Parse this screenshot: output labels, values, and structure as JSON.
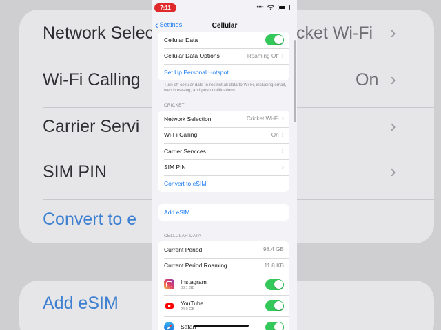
{
  "status_bar": {
    "time": "7:11"
  },
  "nav": {
    "back_label": "Settings",
    "title": "Cellular"
  },
  "top_group": {
    "cellular_data_label": "Cellular Data",
    "options_label": "Cellular Data Options",
    "options_value": "Roaming Off",
    "hotspot_label": "Set Up Personal Hotspot"
  },
  "footnote": "Turn off cellular data to restrict all data to Wi-Fi, including email, web browsing, and push notifications.",
  "carrier": {
    "header": "CRICKET",
    "network_selection_label": "Network Selection",
    "network_selection_value": "Cricket Wi-Fi",
    "wifi_calling_label": "Wi-Fi Calling",
    "wifi_calling_value": "On",
    "carrier_services_label": "Carrier Services",
    "sim_pin_label": "SIM PIN",
    "convert_label": "Convert to eSIM"
  },
  "add_esim_label": "Add eSIM",
  "cellular_data_section": {
    "header": "CELLULAR DATA",
    "current_period_label": "Current Period",
    "current_period_value": "98.4 GB",
    "roaming_label": "Current Period Roaming",
    "roaming_value": "11.8 KB",
    "apps": [
      {
        "name": "Instagram",
        "usage": "33.1 GB",
        "icon": "instagram-icon",
        "enabled": true
      },
      {
        "name": "YouTube",
        "usage": "24.0 GB",
        "icon": "youtube-icon",
        "enabled": true
      },
      {
        "name": "Safari",
        "usage": "",
        "icon": "safari-icon",
        "enabled": true
      }
    ]
  },
  "background": {
    "network_selection_label": "Network Selec",
    "network_selection_value": "cket Wi-Fi",
    "wifi_calling_label": "Wi-Fi Calling",
    "wifi_calling_value": "On",
    "carrier_services_label": "Carrier Servi",
    "sim_pin_label": "SIM PIN",
    "convert_label": "Convert to e",
    "add_esim_label": "Add eSIM"
  },
  "colors": {
    "accent": "#1b7cf0",
    "toggle_on": "#34c759",
    "time_pill": "#e0292b"
  }
}
